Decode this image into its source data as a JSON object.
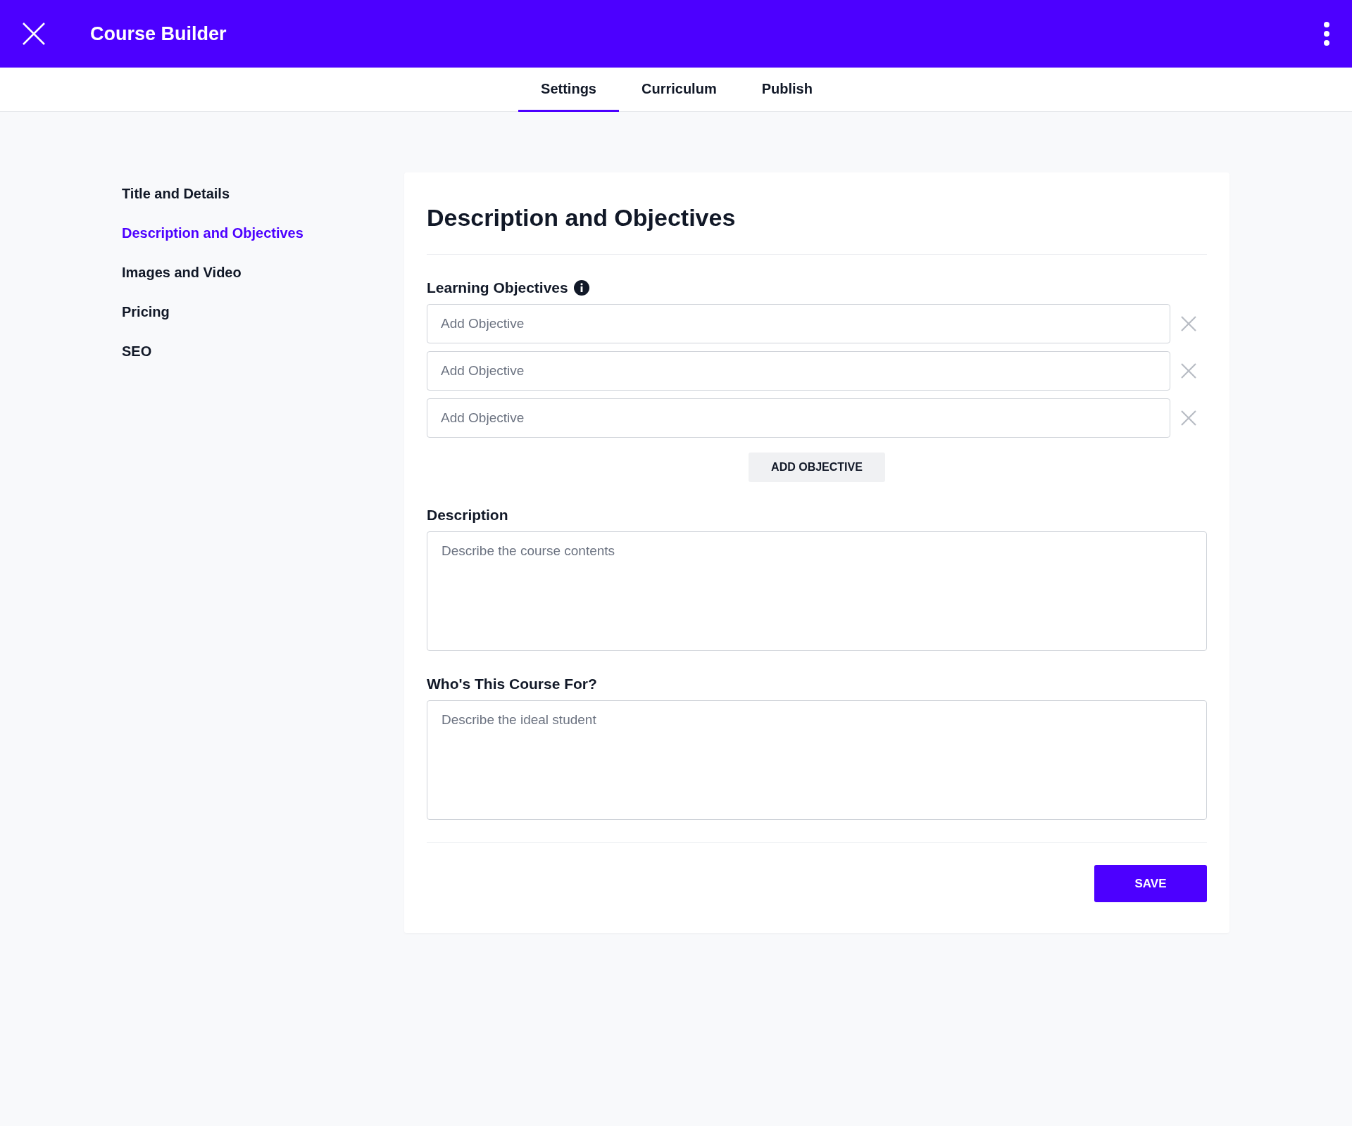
{
  "header": {
    "title": "Course Builder"
  },
  "tabs": [
    {
      "label": "Settings",
      "selected": true
    },
    {
      "label": "Curriculum",
      "selected": false
    },
    {
      "label": "Publish",
      "selected": false
    }
  ],
  "sidebar": {
    "items": [
      {
        "label": "Title and Details",
        "selected": false
      },
      {
        "label": "Description and Objectives",
        "selected": true
      },
      {
        "label": "Images and Video",
        "selected": false
      },
      {
        "label": "Pricing",
        "selected": false
      },
      {
        "label": "SEO",
        "selected": false
      }
    ]
  },
  "panel": {
    "title": "Description and Objectives",
    "objectives": {
      "label": "Learning Objectives",
      "fields": [
        {
          "placeholder": "Add Objective"
        },
        {
          "placeholder": "Add Objective"
        },
        {
          "placeholder": "Add Objective"
        }
      ],
      "add_button": "ADD OBJECTIVE"
    },
    "description": {
      "label": "Description",
      "placeholder": "Describe the course contents"
    },
    "audience": {
      "label": "Who's This Course For?",
      "placeholder": "Describe the ideal student"
    },
    "save_button": "SAVE"
  }
}
